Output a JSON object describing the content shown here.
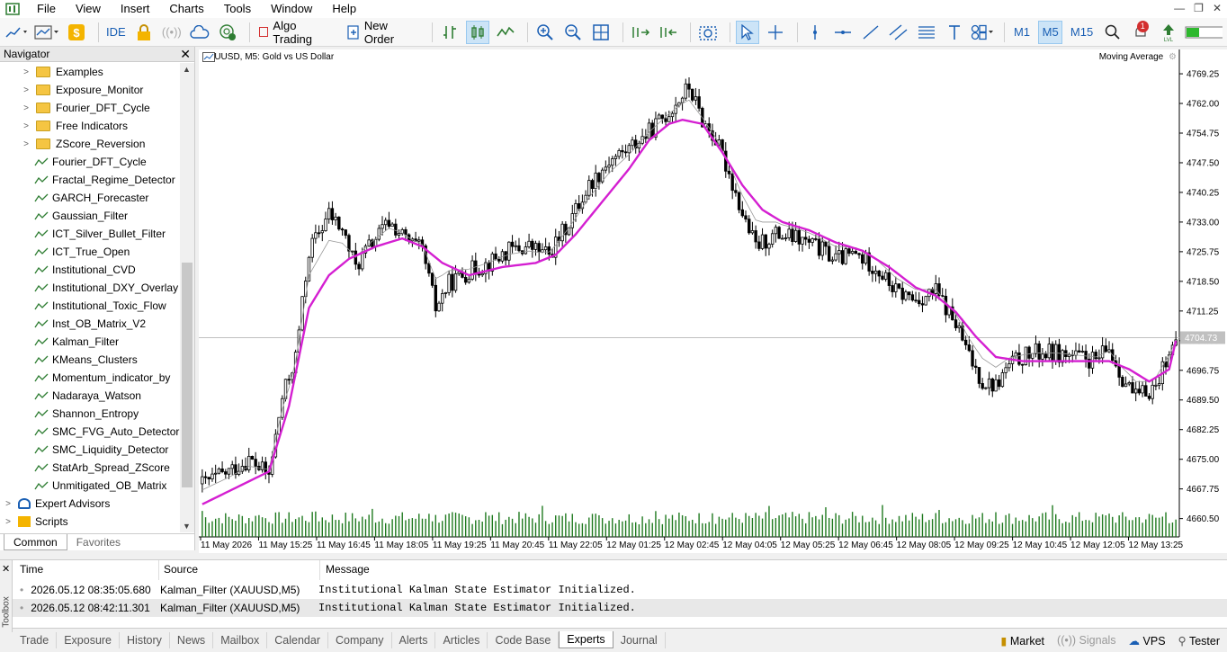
{
  "menu": [
    "File",
    "View",
    "Insert",
    "Charts",
    "Tools",
    "Window",
    "Help"
  ],
  "toolbar": {
    "ide_label": "IDE",
    "algo_trading_label": "Algo Trading",
    "new_order_label": "New Order",
    "timeframes": [
      "M1",
      "M5",
      "M15"
    ],
    "active_timeframe": "M5",
    "notification_count": "1"
  },
  "navigator": {
    "title": "Navigator",
    "items": [
      {
        "label": "Examples",
        "type": "folder"
      },
      {
        "label": "Exposure_Monitor",
        "type": "folder"
      },
      {
        "label": "Fourier_DFT_Cycle",
        "type": "folder"
      },
      {
        "label": "Free Indicators",
        "type": "folder"
      },
      {
        "label": "ZScore_Reversion",
        "type": "folder"
      },
      {
        "label": "Fourier_DFT_Cycle",
        "type": "indicator"
      },
      {
        "label": "Fractal_Regime_Detector",
        "type": "indicator"
      },
      {
        "label": "GARCH_Forecaster",
        "type": "indicator"
      },
      {
        "label": "Gaussian_Filter",
        "type": "indicator"
      },
      {
        "label": "ICT_Silver_Bullet_Filter",
        "type": "indicator"
      },
      {
        "label": "ICT_True_Open",
        "type": "indicator"
      },
      {
        "label": "Institutional_CVD",
        "type": "indicator"
      },
      {
        "label": "Institutional_DXY_Overlay",
        "type": "indicator"
      },
      {
        "label": "Institutional_Toxic_Flow",
        "type": "indicator"
      },
      {
        "label": "Inst_OB_Matrix_V2",
        "type": "indicator"
      },
      {
        "label": "Kalman_Filter",
        "type": "indicator"
      },
      {
        "label": "KMeans_Clusters",
        "type": "indicator"
      },
      {
        "label": "Momentum_indicator_by",
        "type": "indicator"
      },
      {
        "label": "Nadaraya_Watson",
        "type": "indicator"
      },
      {
        "label": "Shannon_Entropy",
        "type": "indicator"
      },
      {
        "label": "SMC_FVG_Auto_Detector",
        "type": "indicator"
      },
      {
        "label": "SMC_Liquidity_Detector",
        "type": "indicator"
      },
      {
        "label": "StatArb_Spread_ZScore",
        "type": "indicator"
      },
      {
        "label": "Unmitigated_OB_Matrix",
        "type": "indicator"
      },
      {
        "label": "Expert Advisors",
        "type": "root"
      },
      {
        "label": "Scripts",
        "type": "root"
      }
    ],
    "tabs": [
      "Common",
      "Favorites"
    ],
    "active_tab": "Common"
  },
  "chart": {
    "title": "XAUUSD, M5:  Gold vs US Dollar",
    "indicator_label": "Moving Average",
    "current_price_label": "4704.73"
  },
  "chart_data": {
    "type": "candlestick",
    "symbol": "XAUUSD",
    "timeframe": "M5",
    "price_ticks": [
      4769.25,
      4762.0,
      4754.75,
      4747.5,
      4740.25,
      4733.0,
      4725.75,
      4718.5,
      4711.25,
      4704.0,
      4696.75,
      4689.5,
      4682.25,
      4675.0,
      4667.75,
      4660.5
    ],
    "ylim": [
      4658.0,
      4773.0
    ],
    "time_labels": [
      "11 May 2026",
      "11 May 15:25",
      "11 May 16:45",
      "11 May 18:05",
      "11 May 19:25",
      "11 May 20:45",
      "11 May 22:05",
      "12 May 01:25",
      "12 May 02:45",
      "12 May 04:05",
      "12 May 05:25",
      "12 May 06:45",
      "12 May 08:05",
      "12 May 09:25",
      "12 May 10:45",
      "12 May 12:05",
      "12 May 13:25"
    ],
    "current_price": 4704.73,
    "price_path": [
      [
        0,
        4669
      ],
      [
        8,
        4672
      ],
      [
        14,
        4675
      ],
      [
        20,
        4671
      ],
      [
        24,
        4690
      ],
      [
        28,
        4700
      ],
      [
        32,
        4726
      ],
      [
        38,
        4735
      ],
      [
        42,
        4731
      ],
      [
        46,
        4722
      ],
      [
        50,
        4727
      ],
      [
        56,
        4733
      ],
      [
        62,
        4728
      ],
      [
        66,
        4726
      ],
      [
        70,
        4712
      ],
      [
        74,
        4718
      ],
      [
        80,
        4721
      ],
      [
        86,
        4723
      ],
      [
        92,
        4726
      ],
      [
        98,
        4727
      ],
      [
        104,
        4725
      ],
      [
        110,
        4733
      ],
      [
        116,
        4742
      ],
      [
        122,
        4748
      ],
      [
        128,
        4751
      ],
      [
        134,
        4755
      ],
      [
        140,
        4760
      ],
      [
        146,
        4766
      ],
      [
        150,
        4758
      ],
      [
        154,
        4753
      ],
      [
        158,
        4745
      ],
      [
        162,
        4735
      ],
      [
        166,
        4727
      ],
      [
        172,
        4730
      ],
      [
        178,
        4729
      ],
      [
        184,
        4727
      ],
      [
        190,
        4724
      ],
      [
        196,
        4725
      ],
      [
        202,
        4722
      ],
      [
        208,
        4716
      ],
      [
        214,
        4714
      ],
      [
        220,
        4716
      ],
      [
        226,
        4708
      ],
      [
        230,
        4700
      ],
      [
        234,
        4694
      ],
      [
        238,
        4693
      ],
      [
        242,
        4698
      ],
      [
        246,
        4700
      ],
      [
        250,
        4701
      ],
      [
        256,
        4701
      ],
      [
        262,
        4700
      ],
      [
        268,
        4699
      ],
      [
        272,
        4702
      ],
      [
        276,
        4695
      ],
      [
        280,
        4690
      ],
      [
        286,
        4693
      ],
      [
        290,
        4702
      ]
    ],
    "moving_average": [
      [
        0,
        4664
      ],
      [
        10,
        4668
      ],
      [
        20,
        4672
      ],
      [
        26,
        4688
      ],
      [
        32,
        4712
      ],
      [
        38,
        4720
      ],
      [
        44,
        4724
      ],
      [
        52,
        4727
      ],
      [
        60,
        4729
      ],
      [
        66,
        4727
      ],
      [
        72,
        4723
      ],
      [
        80,
        4720
      ],
      [
        90,
        4722
      ],
      [
        100,
        4723
      ],
      [
        106,
        4725
      ],
      [
        112,
        4730
      ],
      [
        120,
        4738
      ],
      [
        128,
        4746
      ],
      [
        134,
        4753
      ],
      [
        140,
        4757
      ],
      [
        144,
        4758
      ],
      [
        150,
        4757
      ],
      [
        156,
        4750
      ],
      [
        162,
        4742
      ],
      [
        168,
        4736
      ],
      [
        174,
        4733
      ],
      [
        182,
        4731
      ],
      [
        190,
        4728
      ],
      [
        198,
        4726
      ],
      [
        206,
        4722
      ],
      [
        214,
        4717
      ],
      [
        220,
        4715
      ],
      [
        226,
        4711
      ],
      [
        232,
        4705
      ],
      [
        238,
        4700
      ],
      [
        246,
        4699
      ],
      [
        256,
        4699
      ],
      [
        266,
        4699
      ],
      [
        272,
        4699
      ],
      [
        278,
        4697
      ],
      [
        284,
        4694
      ],
      [
        290,
        4697
      ],
      [
        292,
        4704
      ]
    ]
  },
  "toolbox": {
    "side_label": "Toolbox",
    "columns": [
      "Time",
      "Source",
      "Message"
    ],
    "rows": [
      {
        "time": "2026.05.12 08:35:05.680",
        "source": "Kalman_Filter (XAUUSD,M5)",
        "message": "Institutional Kalman State Estimator Initialized."
      },
      {
        "time": "2026.05.12 08:42:11.301",
        "source": "Kalman_Filter (XAUUSD,M5)",
        "message": "Institutional Kalman State Estimator Initialized."
      }
    ]
  },
  "bottom_tabs": [
    "Trade",
    "Exposure",
    "History",
    "News",
    "Mailbox",
    "Calendar",
    "Company",
    "Alerts",
    "Articles",
    "Code Base",
    "Experts",
    "Journal"
  ],
  "active_bottom_tab": "Experts",
  "status": {
    "market": "Market",
    "signals": "Signals",
    "vps": "VPS",
    "tester": "Tester"
  },
  "colors": {
    "ma": "#d41fd1",
    "volume": "#1f7a1f",
    "accent": "#1a5fb4"
  }
}
